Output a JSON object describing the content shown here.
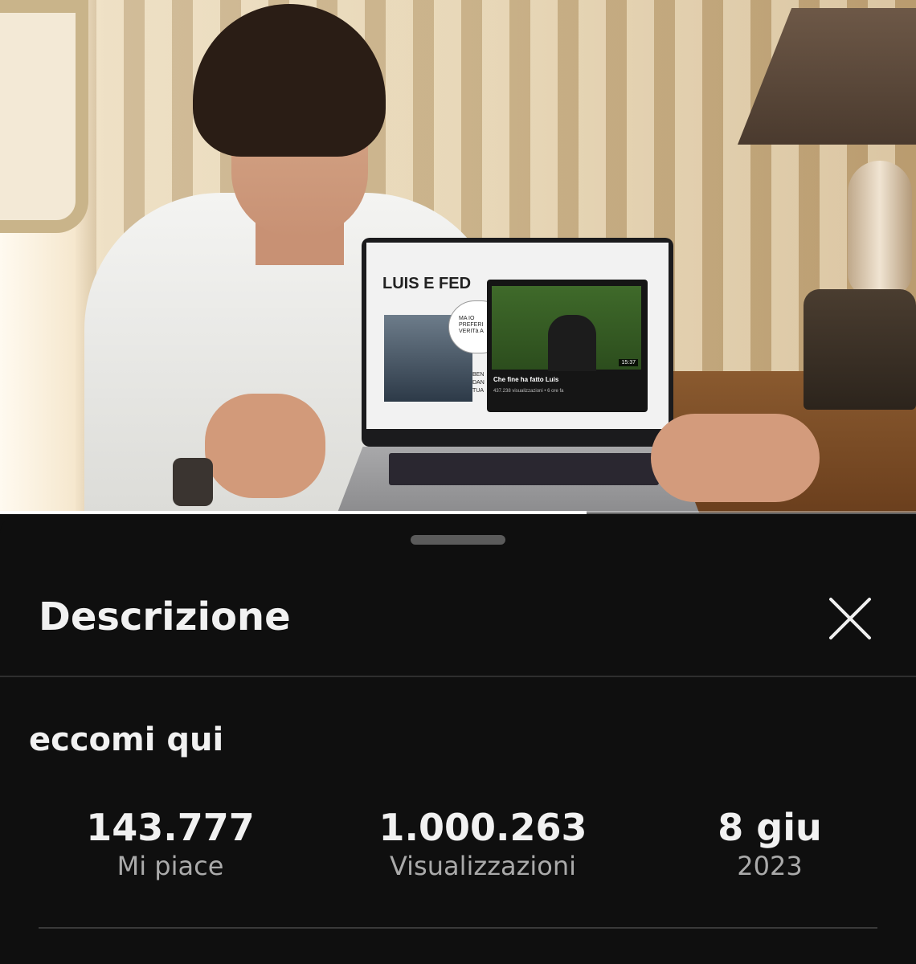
{
  "video": {
    "laptop_screen": {
      "slide_title": "LUIS E FED",
      "bubble_text": "MA IO\nPREFERI\nVERITà A",
      "slide_caption": "BEN\nDAN\nTUA",
      "card": {
        "title": "Che fine ha fatto Luis",
        "meta": "437.238 visualizzazioni • 6 ore fa",
        "duration": "15:37"
      }
    },
    "progress_percent": 64
  },
  "panel": {
    "header_title": "Descrizione",
    "close_icon": "close-icon",
    "video_title": "eccomi qui",
    "stats": {
      "likes": {
        "value": "143.777",
        "label": "Mi piace"
      },
      "views": {
        "value": "1.000.263",
        "label": "Visualizzazioni"
      },
      "date": {
        "value": "8 giu",
        "label": "2023"
      }
    }
  },
  "colors": {
    "background": "#0f0f0f",
    "text_primary": "#f1f1f1",
    "text_secondary": "#aaaaaa",
    "handle": "#5b5b5b"
  }
}
